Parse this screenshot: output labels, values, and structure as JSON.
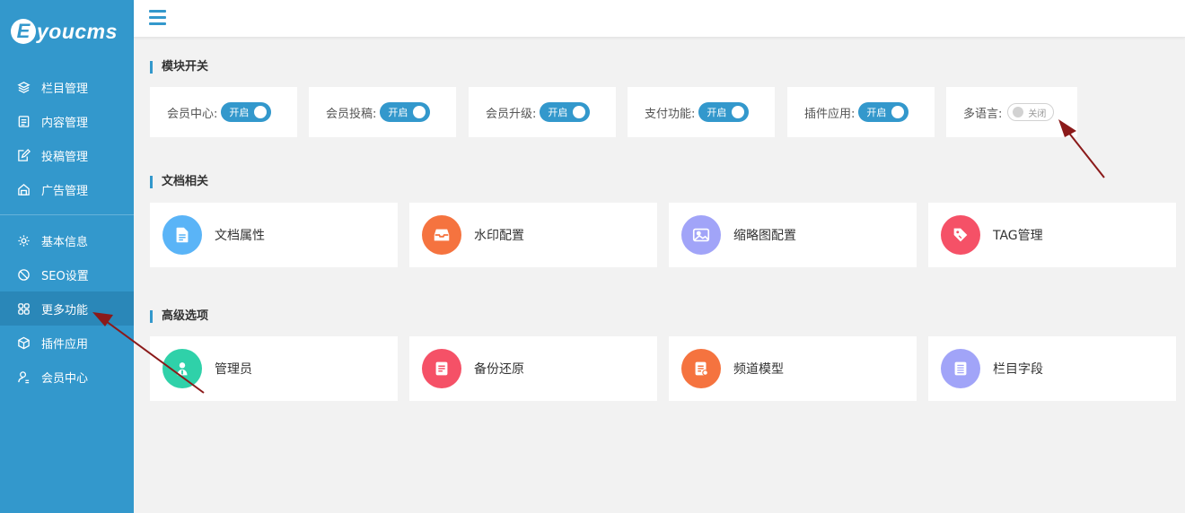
{
  "logo": {
    "mark": "E",
    "text": "youcms"
  },
  "sidebar": {
    "group1": [
      {
        "label": "栏目管理",
        "icon": "layers-icon"
      },
      {
        "label": "内容管理",
        "icon": "document-icon"
      },
      {
        "label": "投稿管理",
        "icon": "edit-icon"
      },
      {
        "label": "广告管理",
        "icon": "megaphone-icon"
      }
    ],
    "group2": [
      {
        "label": "基本信息",
        "icon": "gear-icon"
      },
      {
        "label": "SEO设置",
        "icon": "no-entry-icon"
      },
      {
        "label": "更多功能",
        "icon": "grid-icon",
        "active": true
      },
      {
        "label": "插件应用",
        "icon": "cube-icon"
      },
      {
        "label": "会员中心",
        "icon": "user-icon"
      }
    ]
  },
  "sections": {
    "modules": "模块开关",
    "documents": "文档相关",
    "advanced": "高级选项"
  },
  "switches": [
    {
      "label": "会员中心:",
      "state": "开启",
      "on": true
    },
    {
      "label": "会员投稿:",
      "state": "开启",
      "on": true
    },
    {
      "label": "会员升级:",
      "state": "开启",
      "on": true
    },
    {
      "label": "支付功能:",
      "state": "开启",
      "on": true
    },
    {
      "label": "插件应用:",
      "state": "开启",
      "on": true
    },
    {
      "label": "多语言:",
      "state": "关闭",
      "on": false
    }
  ],
  "documents": [
    {
      "label": "文档属性",
      "icon": "file-icon",
      "color": "#5ab4f7"
    },
    {
      "label": "水印配置",
      "icon": "inbox-icon",
      "color": "#f5733f"
    },
    {
      "label": "缩略图配置",
      "icon": "image-icon",
      "color": "#a1a4f8"
    },
    {
      "label": "TAG管理",
      "icon": "tag-icon",
      "color": "#f55167"
    }
  ],
  "advanced": [
    {
      "label": "管理员",
      "icon": "admin-icon",
      "color": "#2fd1a9"
    },
    {
      "label": "备份还原",
      "icon": "backup-icon",
      "color": "#f55167"
    },
    {
      "label": "频道模型",
      "icon": "channel-icon",
      "color": "#f5733f"
    },
    {
      "label": "栏目字段",
      "icon": "list-icon",
      "color": "#a1a4f8"
    }
  ],
  "colors": {
    "sidebar": "#3398cc",
    "sidebar_active": "#2a87b8",
    "arrow": "#8b1a1a"
  }
}
